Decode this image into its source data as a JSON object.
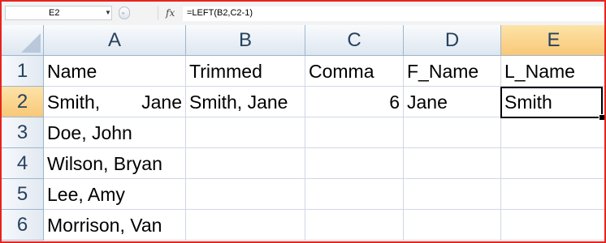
{
  "formula_bar": {
    "name_box": "E2",
    "fx_label": "fx",
    "formula": "=LEFT(B2,C2-1)"
  },
  "columns": [
    "A",
    "B",
    "C",
    "D",
    "E"
  ],
  "selected_column": "E",
  "rows": [
    "1",
    "2",
    "3",
    "4",
    "5",
    "6"
  ],
  "selected_row": "2",
  "cells": {
    "A1": "Name",
    "B1": "Trimmed",
    "C1": "Comma",
    "D1": "F_Name",
    "E1": "L_Name",
    "A2_part1": "Smith,",
    "A2_part2": "Jane",
    "B2": "Smith, Jane",
    "C2": "6",
    "D2": "Jane",
    "E2": "Smith",
    "A3": "Doe, John",
    "A4": "Wilson, Bryan",
    "A5": "Lee, Amy",
    "A6": "Morrison, Van"
  },
  "active_cell": "E2",
  "colors": {
    "frame_border": "#e8231f",
    "header_selected": "#f8c878",
    "grid_line": "#d0d7e5",
    "header_text": "#27415f"
  }
}
